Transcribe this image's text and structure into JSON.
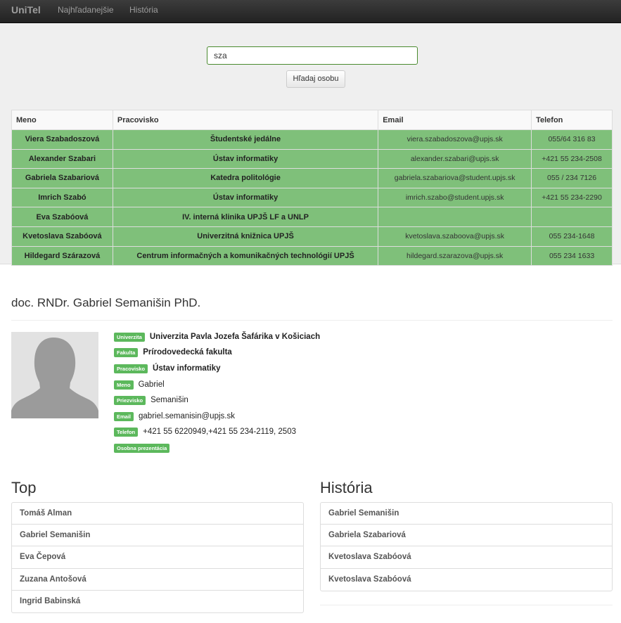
{
  "navbar": {
    "brand": "UniTel",
    "links": [
      "Najhľadanejšie",
      "História"
    ]
  },
  "search": {
    "value": "sza",
    "button_label": "Hľadaj osobu"
  },
  "results": {
    "columns": [
      "Meno",
      "Pracovisko",
      "Email",
      "Telefon"
    ],
    "rows": [
      {
        "name": "Viera Szabadoszová",
        "dept": "Študentské jedálne",
        "email": "viera.szabadoszova@upjs.sk",
        "phone": "055/64 316 83"
      },
      {
        "name": "Alexander Szabari",
        "dept": "Ústav informatiky",
        "email": "alexander.szabari@upjs.sk",
        "phone": "+421 55 234-2508"
      },
      {
        "name": "Gabriela Szabariová",
        "dept": "Katedra politológie",
        "email": "gabriela.szabariova@student.upjs.sk",
        "phone": "055 / 234 7126"
      },
      {
        "name": "Imrich Szabó",
        "dept": "Ústav informatiky",
        "email": "imrich.szabo@student.upjs.sk",
        "phone": "+421 55 234-2290"
      },
      {
        "name": "Eva Szabóová",
        "dept": "IV. interná klinika UPJŠ LF a UNLP",
        "email": "",
        "phone": ""
      },
      {
        "name": "Kvetoslava Szabóová",
        "dept": "Univerzitná knižnica UPJŠ",
        "email": "kvetoslava.szaboova@upjs.sk",
        "phone": "055 234-1648"
      },
      {
        "name": "Hildegard Szárazová",
        "dept": "Centrum informačných a komunikačných technológií UPJŠ",
        "email": "hildegard.szarazova@upjs.sk",
        "phone": "055 234 1633"
      }
    ]
  },
  "person": {
    "title": "doc. RNDr. Gabriel Semanišin PhD.",
    "avatar_icon": "user-silhouette-icon",
    "fields": [
      {
        "label": "Univerzita",
        "value": "Univerzita Pavla Jozefa Šafárika v Košiciach"
      },
      {
        "label": "Fakulta",
        "value": "Prírodovedecká fakulta"
      },
      {
        "label": "Pracovisko",
        "value": "Ústav informatiky"
      },
      {
        "label": "Meno",
        "value": "Gabriel"
      },
      {
        "label": "Priezvisko",
        "value": "Semanišin"
      },
      {
        "label": "Email",
        "value": "gabriel.semanisin@upjs.sk"
      },
      {
        "label": "Telefon",
        "value": "+421 55 6220949,+421 55 234-2119, 2503"
      }
    ],
    "presentation_label": "Osobna prezentácia"
  },
  "top": {
    "title": "Top",
    "items": [
      "Tomáš Alman",
      "Gabriel Semanišin",
      "Eva Čepová",
      "Zuzana Antošová",
      "Ingrid Babinská"
    ]
  },
  "history": {
    "title": "História",
    "items": [
      "Gabriel Semanišin",
      "Gabriela Szabariová",
      "Kvetoslava Szabóová",
      "Kvetoslava Szabóová"
    ]
  },
  "colors": {
    "navbar": "#222222",
    "row_highlight": "#7fc07a",
    "badge": "#5cb85c"
  }
}
